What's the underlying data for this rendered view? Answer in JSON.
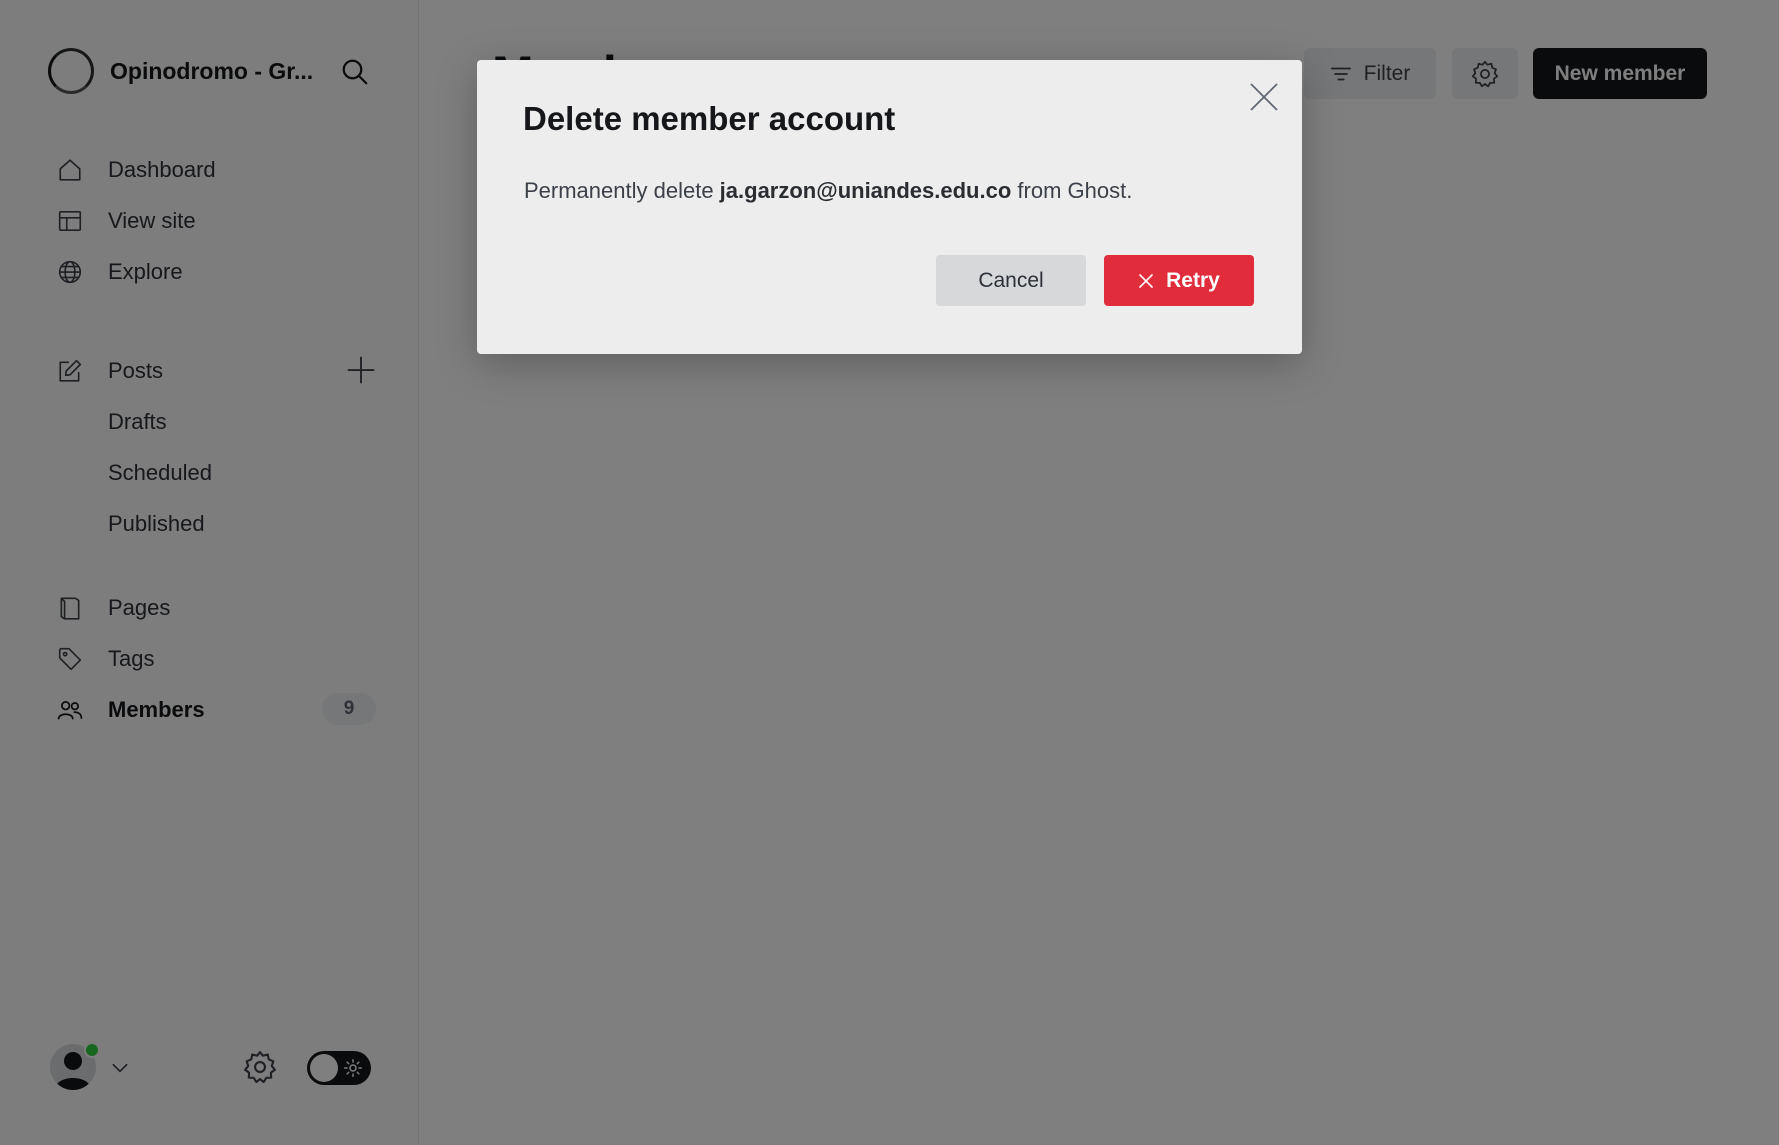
{
  "sidebar": {
    "site_name": "Opinodromo - Gr...",
    "nav_primary": [
      {
        "label": "Dashboard",
        "icon": "home-icon"
      },
      {
        "label": "View site",
        "icon": "layout-icon"
      },
      {
        "label": "Explore",
        "icon": "globe-icon"
      }
    ],
    "posts": {
      "label": "Posts",
      "icon": "edit-icon"
    },
    "post_subitems": [
      {
        "label": "Drafts"
      },
      {
        "label": "Scheduled"
      },
      {
        "label": "Published"
      }
    ],
    "pages": {
      "label": "Pages",
      "icon": "book-icon"
    },
    "tags": {
      "label": "Tags",
      "icon": "tag-icon"
    },
    "members": {
      "label": "Members",
      "icon": "users-icon",
      "count": "9"
    }
  },
  "main": {
    "title": "Members",
    "filter_label": "Filter",
    "new_member_label": "New member"
  },
  "modal": {
    "title": "Delete member account",
    "body_prefix": "Permanently delete ",
    "email": "ja.garzon@uniandes.edu.co",
    "body_suffix": " from Ghost.",
    "cancel_label": "Cancel",
    "retry_label": "Retry"
  },
  "colors": {
    "primary_dark": "#15171a",
    "danger": "#e12c3c",
    "status_online": "#30cf43"
  }
}
